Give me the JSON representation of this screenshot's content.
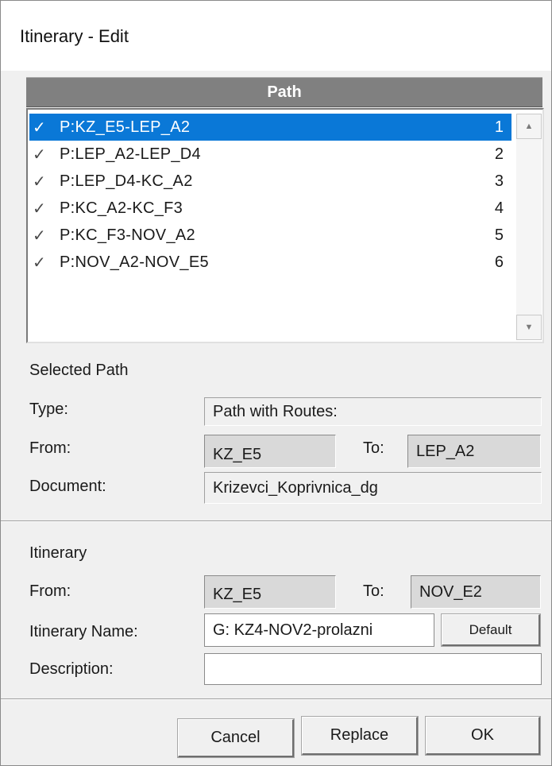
{
  "window": {
    "title": "Itinerary - Edit"
  },
  "path_list": {
    "header": "Path",
    "items": [
      {
        "label": "P:KZ_E5-LEP_A2",
        "index": "1",
        "selected": true
      },
      {
        "label": "P:LEP_A2-LEP_D4",
        "index": "2",
        "selected": false
      },
      {
        "label": "P:LEP_D4-KC_A2",
        "index": "3",
        "selected": false
      },
      {
        "label": "P:KC_A2-KC_F3",
        "index": "4",
        "selected": false
      },
      {
        "label": "P:KC_F3-NOV_A2",
        "index": "5",
        "selected": false
      },
      {
        "label": "P:NOV_A2-NOV_E5",
        "index": "6",
        "selected": false
      }
    ],
    "check_glyph": "✓",
    "scroll_up_glyph": "▲",
    "scroll_down_glyph": "▼"
  },
  "selected_path": {
    "section_label": "Selected Path",
    "type_label": "Type:",
    "type_value": "Path with Routes:",
    "from_label": "From:",
    "from_value": "KZ_E5",
    "to_label": "To:",
    "to_value": "LEP_A2",
    "document_label": "Document:",
    "document_value": "Krizevci_Koprivnica_dg"
  },
  "itinerary": {
    "section_label": "Itinerary",
    "from_label": "From:",
    "from_value": "KZ_E5",
    "to_label": "To:",
    "to_value": "NOV_E2",
    "name_label": "Itinerary Name:",
    "name_value": "G: KZ4-NOV2-prolazni",
    "default_button": "Default",
    "description_label": "Description:",
    "description_value": ""
  },
  "buttons": {
    "cancel": "Cancel",
    "replace": "Replace",
    "ok": "OK"
  },
  "colors": {
    "selection": "#0a78d7",
    "header": "#808080",
    "dialog_bg": "#f0f0f0"
  }
}
